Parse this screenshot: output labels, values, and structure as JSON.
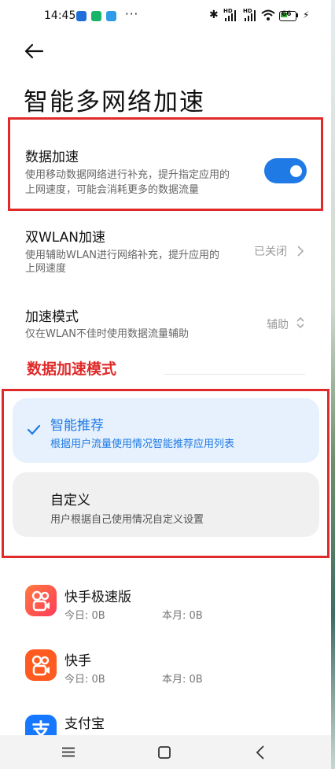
{
  "status_bar": {
    "time": "14:45",
    "dots": "···",
    "hd1": "HD",
    "hd2": "HD",
    "battery": "66",
    "app_icon_colors": [
      "#1e6fd9",
      "#19b36b",
      "#2f9be8"
    ]
  },
  "header": {
    "back_icon": "back-arrow-icon",
    "title": "智能多网络加速"
  },
  "data_accel": {
    "title": "数据加速",
    "sub1": "使用移动数据网络进行补充，提升指定应用的",
    "sub2": "上网速度，可能会消耗更多的数据流量",
    "toggle_on": true
  },
  "dual_wlan": {
    "title": "双WLAN加速",
    "sub1": "使用辅助WLAN进行网络补充，提升应用的",
    "sub2": "上网速度",
    "value": "已关闭"
  },
  "accel_mode": {
    "title": "加速模式",
    "sub": "仅在WLAN不佳时使用数据流量辅助",
    "value": "辅助"
  },
  "section_label": "数据加速模式",
  "options": [
    {
      "title": "智能推荐",
      "sub": "根据用户流量使用情况智能推荐应用列表",
      "selected": true
    },
    {
      "title": "自定义",
      "sub": "用户根据自己使用情况自定义设置",
      "selected": false
    }
  ],
  "apps": [
    {
      "name": "快手极速版",
      "today": "今日: 0B",
      "month": "本月: 0B",
      "icon": "kuaishou-lite-icon"
    },
    {
      "name": "快手",
      "today": "今日: 0B",
      "month": "本月: 0B",
      "icon": "kuaishou-icon"
    },
    {
      "name": "支付宝",
      "icon": "alipay-icon",
      "icon_text": "支"
    }
  ],
  "nav": {
    "menu_icon": "menu-icon",
    "home_icon": "home-icon",
    "back_icon": "back-icon"
  },
  "colors": {
    "accent": "#1f7ae6",
    "annotation_red": "#e02a2a",
    "selected_bg": "#e6f1fd",
    "unselected_bg": "#f0f0f0"
  }
}
